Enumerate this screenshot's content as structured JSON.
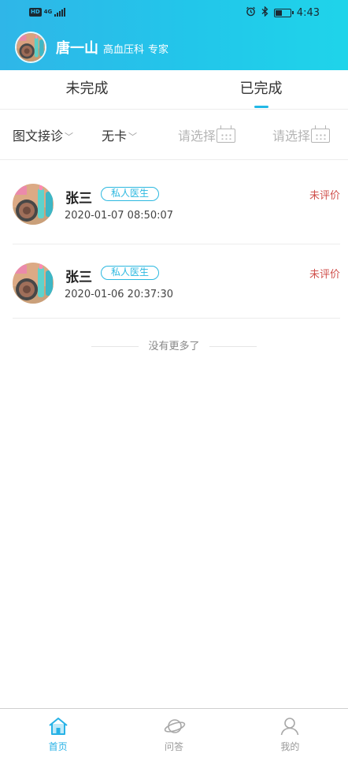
{
  "status_bar": {
    "hd": "HD",
    "network": "4G",
    "time": "4:43",
    "battery_level": 0.45
  },
  "header": {
    "doctor_name": "唐一山",
    "department": "高血压科",
    "title": "专家"
  },
  "tabs": [
    {
      "label": "未完成",
      "active": false
    },
    {
      "label": "已完成",
      "active": true
    }
  ],
  "filters": {
    "service_type": "图文接诊",
    "card_type": "无卡",
    "start_date_placeholder": "请选择",
    "end_date_placeholder": "请选择"
  },
  "records": [
    {
      "name": "张三",
      "tag": "私人医生",
      "time": "2020-01-07 08:50:07",
      "status": "未评价"
    },
    {
      "name": "张三",
      "tag": "私人医生",
      "time": "2020-01-06 20:37:30",
      "status": "未评价"
    }
  ],
  "list_footer": "没有更多了",
  "bottom_nav": [
    {
      "label": "首页",
      "icon": "home-icon",
      "active": true
    },
    {
      "label": "问答",
      "icon": "planet-icon",
      "active": false
    },
    {
      "label": "我的",
      "icon": "user-icon",
      "active": false
    }
  ],
  "colors": {
    "header_start": "#2fb6e8",
    "header_end": "#1fd4ea",
    "accent": "#22b8e6",
    "status_red": "#d0504c"
  }
}
